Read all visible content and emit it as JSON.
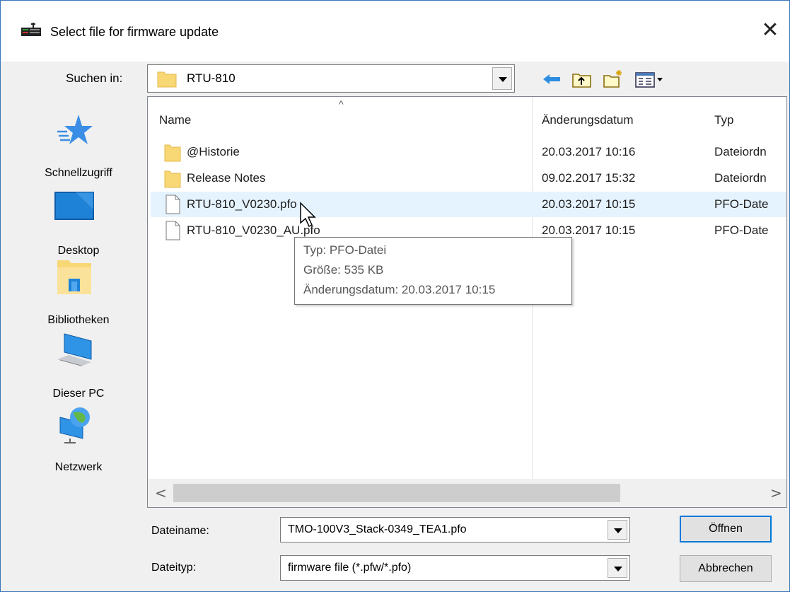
{
  "dialog": {
    "title": "Select file for firmware update",
    "close_glyph": "✕"
  },
  "lookin": {
    "label": "Suchen in:",
    "value": "RTU-810"
  },
  "toolbar": {
    "icons": [
      "back-arrow-icon",
      "up-folder-icon",
      "new-folder-icon",
      "view-menu-icon"
    ]
  },
  "places": [
    {
      "label": "Schnellzugriff",
      "icon": "star-icon"
    },
    {
      "label": "Desktop",
      "icon": "desktop-icon"
    },
    {
      "label": "Bibliotheken",
      "icon": "libraries-icon"
    },
    {
      "label": "Dieser PC",
      "icon": "computer-icon"
    },
    {
      "label": "Netzwerk",
      "icon": "network-icon"
    }
  ],
  "columns": {
    "name": "Name",
    "date": "Änderungsdatum",
    "type": "Typ",
    "sort_glyph": "^"
  },
  "files": [
    {
      "name": "@Historie",
      "date": "20.03.2017 10:16",
      "type": "Dateiordn",
      "icon": "folder-icon"
    },
    {
      "name": "Release Notes",
      "date": "09.02.2017 15:32",
      "type": "Dateiordn",
      "icon": "folder-icon"
    },
    {
      "name": "RTU-810_V0230.pfo",
      "date": "20.03.2017 10:15",
      "type": "PFO-Date",
      "icon": "file-icon"
    },
    {
      "name": "RTU-810_V0230_AU.pfo",
      "date": "20.03.2017 10:15",
      "type": "PFO-Date",
      "icon": "file-icon"
    }
  ],
  "tooltip": {
    "type": "Typ: PFO-Datei",
    "size": "Größe: 535 KB",
    "date": "Änderungsdatum: 20.03.2017 10:15"
  },
  "scroll": {
    "left_glyph": "<",
    "right_glyph": ">"
  },
  "filename": {
    "label": "Dateiname:",
    "value": "TMO-100V3_Stack-0349_TEA1.pfo"
  },
  "filetype": {
    "label": "Dateityp:",
    "value": "firmware file (*.pfw/*.pfo)"
  },
  "buttons": {
    "open": "Öffnen",
    "cancel": "Abbrechen"
  },
  "colors": {
    "accent": "#0078d7",
    "hover_row": "#e5f3ff",
    "folder": "#f8d775"
  }
}
